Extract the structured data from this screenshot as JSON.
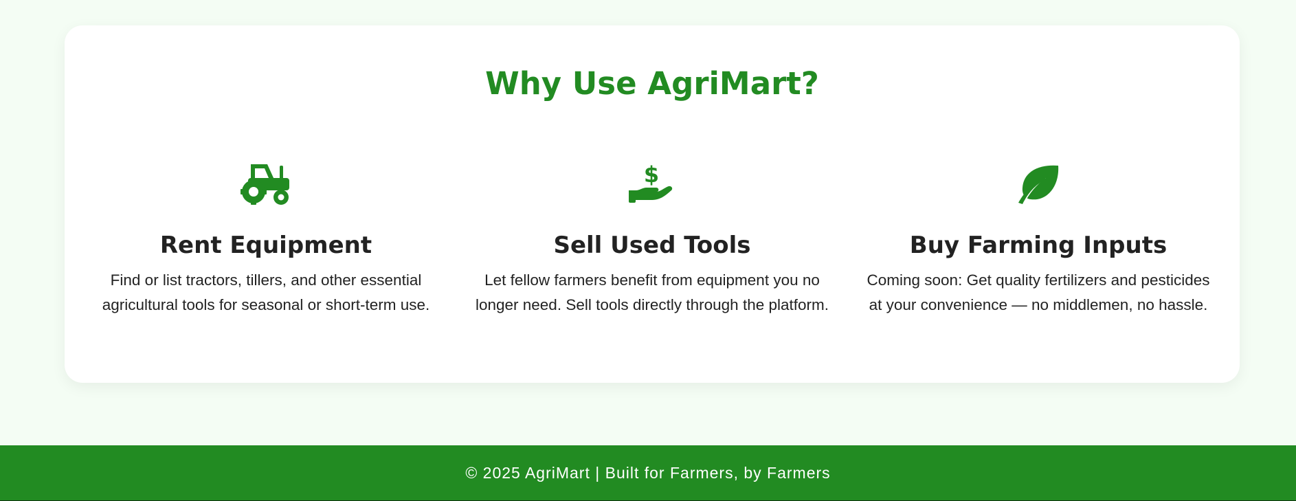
{
  "section": {
    "title": "Why Use AgriMart?"
  },
  "features": [
    {
      "icon": "tractor-icon",
      "title": "Rent Equipment",
      "description": "Find or list tractors, tillers, and other essential agricultural tools for seasonal or short-term use."
    },
    {
      "icon": "hand-dollar-icon",
      "title": "Sell Used Tools",
      "description": "Let fellow farmers benefit from equipment you no longer need. Sell tools directly through the platform."
    },
    {
      "icon": "leaf-icon",
      "title": "Buy Farming Inputs",
      "description": "Coming soon: Get quality fertilizers and pesticides at your convenience — no middlemen, no hassle."
    }
  ],
  "footer": {
    "text": "© 2025 AgriMart | Built for Farmers, by Farmers"
  },
  "colors": {
    "brand_green": "#228b22",
    "page_background": "#f4fdf4",
    "card_background": "#ffffff",
    "text_dark": "#222222"
  }
}
